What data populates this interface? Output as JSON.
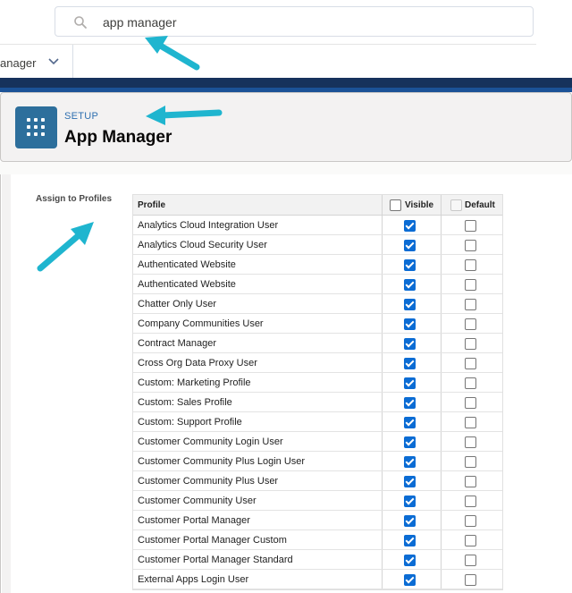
{
  "search": {
    "query": "app manager"
  },
  "nav": {
    "partial_label": "anager"
  },
  "header": {
    "eyebrow": "SETUP",
    "title": "App Manager"
  },
  "assign": {
    "label": "Assign to Profiles",
    "columns": {
      "profile": "Profile",
      "visible": "Visible",
      "default": "Default"
    },
    "rows": [
      {
        "name": "Analytics Cloud Integration User",
        "visible": true,
        "default": false
      },
      {
        "name": "Analytics Cloud Security User",
        "visible": true,
        "default": false
      },
      {
        "name": "Authenticated Website",
        "visible": true,
        "default": false
      },
      {
        "name": "Authenticated Website",
        "visible": true,
        "default": false
      },
      {
        "name": "Chatter Only User",
        "visible": true,
        "default": false
      },
      {
        "name": "Company Communities User",
        "visible": true,
        "default": false
      },
      {
        "name": "Contract Manager",
        "visible": true,
        "default": false
      },
      {
        "name": "Cross Org Data Proxy User",
        "visible": true,
        "default": false
      },
      {
        "name": "Custom: Marketing Profile",
        "visible": true,
        "default": false
      },
      {
        "name": "Custom: Sales Profile",
        "visible": true,
        "default": false
      },
      {
        "name": "Custom: Support Profile",
        "visible": true,
        "default": false
      },
      {
        "name": "Customer Community Login User",
        "visible": true,
        "default": false
      },
      {
        "name": "Customer Community Plus Login User",
        "visible": true,
        "default": false
      },
      {
        "name": "Customer Community Plus User",
        "visible": true,
        "default": false
      },
      {
        "name": "Customer Community User",
        "visible": true,
        "default": false
      },
      {
        "name": "Customer Portal Manager",
        "visible": true,
        "default": false
      },
      {
        "name": "Customer Portal Manager Custom",
        "visible": true,
        "default": false
      },
      {
        "name": "Customer Portal Manager Standard",
        "visible": true,
        "default": false
      },
      {
        "name": "External Apps Login User",
        "visible": true,
        "default": false
      }
    ]
  },
  "colors": {
    "arrow": "#1fb5cf",
    "band": "#16325c",
    "app_icon": "#2d6f9c",
    "checkbox_on": "#0b6cd4"
  }
}
